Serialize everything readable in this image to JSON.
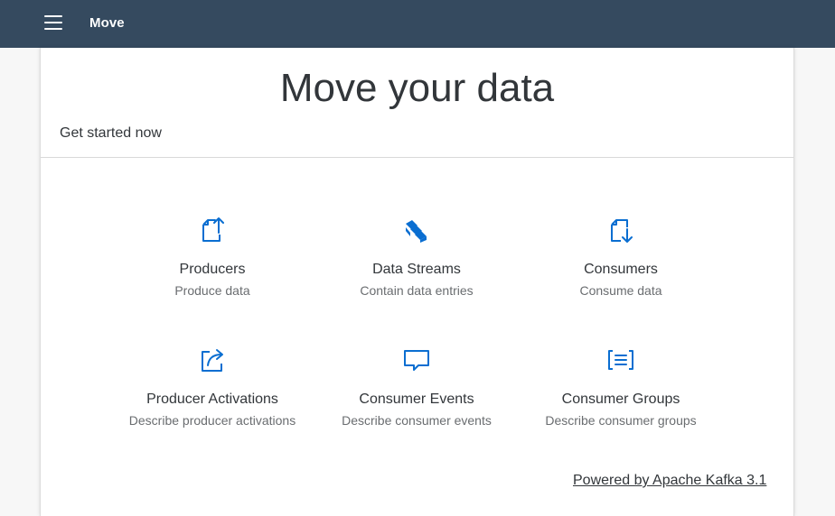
{
  "header": {
    "app_title": "Move",
    "brand_color": "#354a5f",
    "menu_icon": "hamburger-menu-icon"
  },
  "hero": {
    "title": "Move your data",
    "subtitle": "Get started now"
  },
  "tiles": [
    {
      "title": "Producers",
      "subtitle": "Produce data",
      "icon": "document-upload-icon"
    },
    {
      "title": "Data Streams",
      "subtitle": "Contain data entries",
      "icon": "stacked-streams-icon"
    },
    {
      "title": "Consumers",
      "subtitle": "Consume data",
      "icon": "document-download-icon"
    },
    {
      "title": "Producer Activations",
      "subtitle": "Describe producer activations",
      "icon": "share-arrow-icon"
    },
    {
      "title": "Consumer Events",
      "subtitle": "Describe consumer events",
      "icon": "speech-bubble-icon"
    },
    {
      "title": "Consumer Groups",
      "subtitle": "Describe consumer groups",
      "icon": "bracketed-list-icon"
    }
  ],
  "footer": {
    "powered_by": "Powered by Apache Kafka 3.1"
  },
  "accent_color": "#0a6ed1"
}
